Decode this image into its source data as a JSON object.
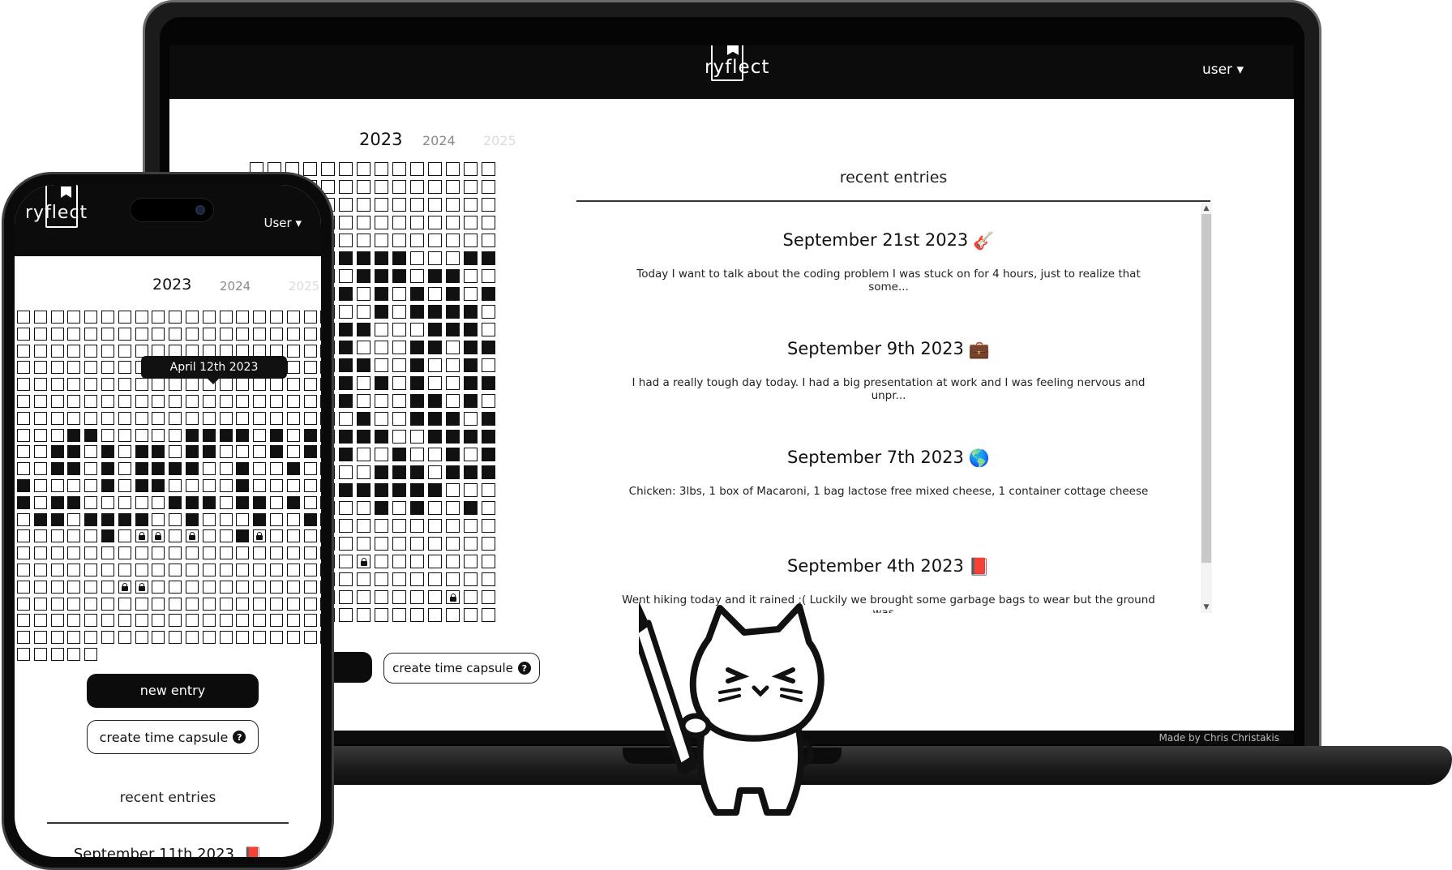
{
  "app": {
    "name": "ryflect"
  },
  "desktop": {
    "user_menu": "user ▾",
    "years": [
      "2023",
      "2024",
      "2025"
    ],
    "buttons": {
      "create_time_capsule": "create time capsule"
    },
    "recent_title": "recent entries",
    "entries": [
      {
        "title": "September 21st 2023",
        "emoji": "🎸",
        "text": "Today I want to talk about the coding problem I was stuck on for 4 hours, just to realize that some..."
      },
      {
        "title": "September 9th 2023",
        "emoji": "💼",
        "text": "I had a really tough day today. I had a big presentation at work and I was feeling nervous and unpr..."
      },
      {
        "title": "September 7th 2023",
        "emoji": "🌎",
        "text": "Chicken: 3lbs, 1 box of Macaroni, 1 bag lactose free mixed cheese, 1 container cottage cheese"
      },
      {
        "title": "September 4th 2023",
        "emoji": "📕",
        "text": "Went hiking today and it rained :( Luckily we brought some garbage bags to wear but the ground was..."
      }
    ],
    "footer": "Made by Chris Christakis"
  },
  "mobile": {
    "user_menu": "User ▾",
    "years": [
      "2023",
      "2024",
      "2025"
    ],
    "tooltip": "April 12th 2023",
    "buttons": {
      "new_entry": "new entry",
      "create_time_capsule": "create time capsule"
    },
    "recent_title": "recent entries",
    "first_entry": "September 11th 2023",
    "first_entry_emoji": "📕"
  },
  "colors": {
    "ink": "#111111",
    "header": "#0c0c0c",
    "background": "#ffffff",
    "muted_year": "#8a8a8a",
    "faded_year": "#dcdcdc"
  },
  "icons": [
    "logo-bookmark-icon",
    "chevron-down-icon",
    "question-circle-icon",
    "lock-icon",
    "pencil-cat-illustration"
  ]
}
